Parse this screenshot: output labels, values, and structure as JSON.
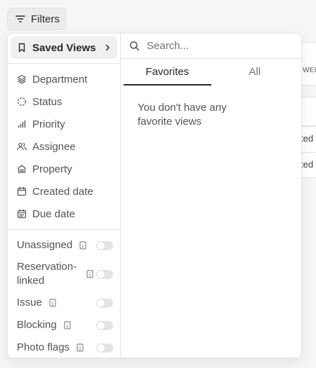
{
  "toolbar": {
    "filters_label": "Filters"
  },
  "background": {
    "fragment_1": "WEI",
    "fragment_2": "ted",
    "fragment_3": "ted"
  },
  "left_panel": {
    "saved_views_label": "Saved Views",
    "filter_items": [
      {
        "label": "Department",
        "icon": "layers-icon"
      },
      {
        "label": "Status",
        "icon": "circle-dashed-icon"
      },
      {
        "label": "Priority",
        "icon": "signal-icon"
      },
      {
        "label": "Assignee",
        "icon": "users-icon"
      },
      {
        "label": "Property",
        "icon": "building-icon"
      },
      {
        "label": "Created date",
        "icon": "calendar-plus-icon"
      },
      {
        "label": "Due date",
        "icon": "calendar-icon"
      }
    ],
    "toggles": [
      {
        "label": "Unassigned",
        "on": false
      },
      {
        "label": "Reservation-linked",
        "on": false
      },
      {
        "label": "Issue",
        "on": false
      },
      {
        "label": "Blocking",
        "on": false
      },
      {
        "label": "Photo flags",
        "on": false
      }
    ]
  },
  "right_panel": {
    "search_placeholder": "Search...",
    "tabs": [
      {
        "label": "Favorites",
        "active": true
      },
      {
        "label": "All",
        "active": false
      }
    ],
    "empty_message": "You don't have any favorite views"
  }
}
